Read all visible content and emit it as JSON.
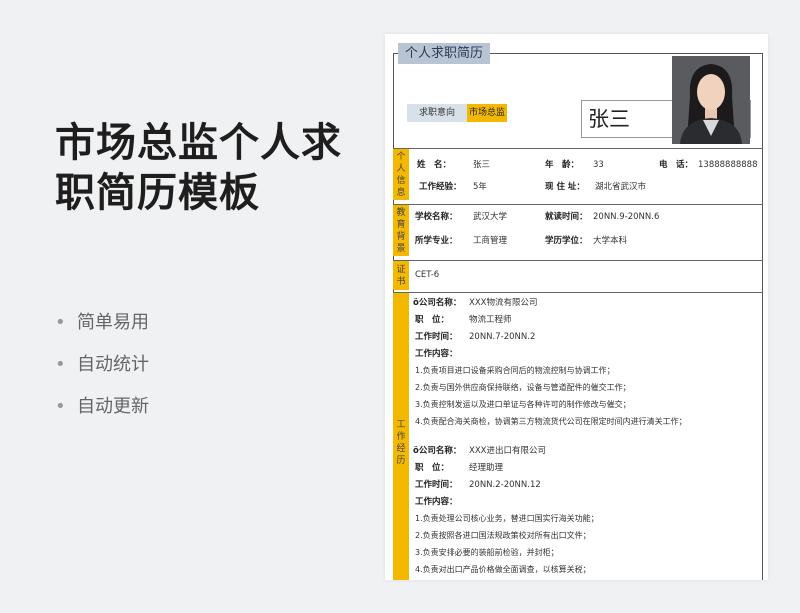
{
  "promo": {
    "title_line1": "市场总监个人求",
    "title_line2": "职简历模板",
    "features": [
      "简单易用",
      "自动统计",
      "自动更新"
    ]
  },
  "resume": {
    "doc_title": "个人求职简历",
    "intent_label": "求职意向",
    "intent_value": "市场总监",
    "name": "张三",
    "personal": {
      "side_label": [
        "个",
        "人",
        "信",
        "息"
      ],
      "name_label": "姓　名：",
      "name_value": "张三",
      "age_label": "年　龄：",
      "age_value": "33",
      "phone_label": "电　话：",
      "phone_value": "13888888888",
      "exp_label": "工作经验：",
      "exp_value": "5年",
      "address_label": "现 住 址：",
      "address_value": "湖北省武汉市"
    },
    "education": {
      "side_label": [
        "教",
        "育",
        "背",
        "景"
      ],
      "school_label": "学校名称：",
      "school_value": "武汉大学",
      "time_label": "就读时间：",
      "time_value": "20NN.9-20NN.6",
      "major_label": "所学专业：",
      "major_value": "工商管理",
      "degree_label": "学历学位：",
      "degree_value": "大学本科"
    },
    "certificate": {
      "side_label": [
        "证",
        "书"
      ],
      "value": "CET-6"
    },
    "work": {
      "side_label": [
        "工",
        "作",
        "经",
        "历"
      ],
      "jobs": [
        {
          "company_label": "ö公司名称：",
          "company_value": "XXX物流有限公司",
          "position_label": "职　位：",
          "position_value": "物流工程师",
          "time_label": "工作时间：",
          "time_value": "20NN.7-20NN.2",
          "content_label": "工作内容：",
          "duties": [
            "1.负责项目进口设备采购合同后的物流控制与协调工作；",
            "2.负责与国外供应商保持联络，设备与管道配件的催交工作；",
            "3.负责控制发运以及进口单证与各种许可的制作修改与催交；",
            "4.负责配合海关商检，协调第三方物流货代公司在限定时间内进行清关工作；"
          ]
        },
        {
          "company_label": "ö公司名称：",
          "company_value": "XXX进出口有限公司",
          "position_label": "职　位：",
          "position_value": "经理助理",
          "time_label": "工作时间：",
          "time_value": "20NN.2-20NN.12",
          "content_label": "工作内容：",
          "duties": [
            "1.负责处理公司核心业务，替进口国实行海关功能；",
            "2.负责按照各进口国法规政策校对所有出口文件；",
            "3.负责安排必要的装船前检验，并封柜；",
            "4.负责对出口产品价格做全面调查，以核算关税；"
          ]
        }
      ]
    }
  }
}
